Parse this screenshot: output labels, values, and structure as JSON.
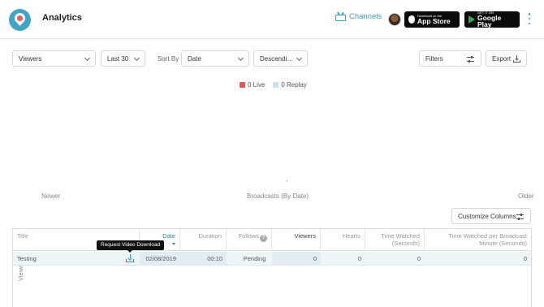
{
  "header": {
    "title": "Analytics",
    "channels_label": "Channels",
    "app_store": {
      "small": "Download on the",
      "big": "App Store"
    },
    "google_play": {
      "small": "GET IT ON",
      "big": "Google Play"
    },
    "icons": [
      "periscope-logo-icon",
      "tv-icon",
      "avatar",
      "apple-icon",
      "google-play-icon",
      "more-vert-icon"
    ],
    "colors": {
      "accent": "#3aa0c0",
      "logo": "#40a4c4"
    }
  },
  "controls": {
    "metric": "Viewers",
    "range": "Last 30",
    "sort_by_label": "Sort By",
    "sort_field": "Date",
    "sort_order": "Descendi…",
    "filters_label": "Filters",
    "export_label": "Export"
  },
  "chart_data": {
    "type": "bar",
    "series": [
      {
        "name": "Live",
        "values": [
          0
        ],
        "color": "#e9584f"
      },
      {
        "name": "Replay",
        "values": [
          0
        ],
        "color": "#c9e1ee"
      }
    ],
    "legend": {
      "live": "0 Live",
      "replay": "0 Replay",
      "placement": "top-center"
    },
    "ylabel": "Viewers",
    "xlabel": "Broadcasts (By Date)",
    "x_left": "Newer",
    "x_right": "Older"
  },
  "table": {
    "customize_label": "Customize Columns",
    "columns": {
      "title": "Title",
      "date": "Date",
      "duration": "Duration",
      "follows": "Follows",
      "viewers": "Viewers",
      "hearts": "Hearts",
      "time_watched": "Time Watched (Seconds)",
      "time_per_minute": "Time Watched per Broadcast Minute (Seconds)"
    },
    "rows": [
      {
        "title": "Testing",
        "date": "02/08/2019",
        "duration": "00:10",
        "follows": "Pending",
        "viewers": "0",
        "hearts": "0",
        "time_watched": "0",
        "time_per_minute": "0"
      }
    ],
    "tooltip": "Request Video Download"
  }
}
